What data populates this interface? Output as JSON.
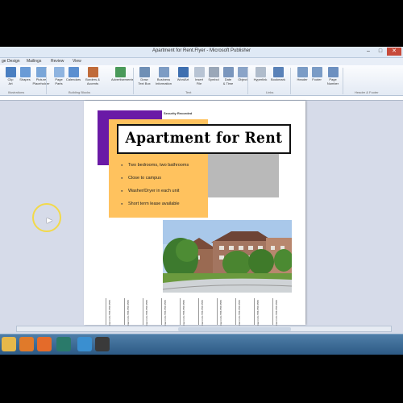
{
  "window": {
    "title": "Apartment for Rent.Flyer - Microsoft Publisher"
  },
  "menu": [
    "ge Design",
    "Mailings",
    "Review",
    "View"
  ],
  "ribbon": {
    "buttons": [
      {
        "label": "Clip\nArt",
        "color": "#4a7fc1"
      },
      {
        "label": "Shapes",
        "color": "#6a9bd6"
      },
      {
        "label": "Picture\nPlaceholder",
        "color": "#7aa6d8"
      },
      {
        "label": "Page\nParts",
        "color": "#8fb4e0"
      },
      {
        "label": "Calendars",
        "color": "#5b8fd0"
      },
      {
        "label": "Borders &\nAccents",
        "color": "#c06b3a"
      },
      {
        "label": "Advertisements",
        "color": "#4a9a5a"
      },
      {
        "label": "Draw\nText Box",
        "color": "#6f8fb5"
      },
      {
        "label": "Business\nInformation",
        "color": "#7d9cc4"
      },
      {
        "label": "WordArt",
        "color": "#3e6fb0"
      },
      {
        "label": "Insert\nFile",
        "color": "#b8c4d4"
      },
      {
        "label": "Symbol",
        "color": "#9aa7b8"
      },
      {
        "label": "Date\n& Time",
        "color": "#7a96bd"
      },
      {
        "label": "Object",
        "color": "#8aa4c8"
      },
      {
        "label": "Hyperlink",
        "color": "#b0bccb"
      },
      {
        "label": "Bookmark",
        "color": "#5a82b8"
      },
      {
        "label": "Header",
        "color": "#7b9cc6"
      },
      {
        "label": "Footer",
        "color": "#7b9cc6"
      },
      {
        "label": "Page\nNumber",
        "color": "#6d90c0"
      }
    ],
    "groups": [
      "Illustrations",
      "Building Blocks",
      "Text",
      "Links",
      "Header & Footer"
    ]
  },
  "document": {
    "title": "Apartment for Rent",
    "control_label": "Security Recorded",
    "bullets": [
      "Two bedrooms, two bathrooms",
      "Close to campus",
      "Washer/Dryer in each unit",
      "Short term lease available"
    ],
    "tear_off_text": "Contact Info 555-555-5555"
  },
  "taskbar": {
    "items": [
      {
        "name": "file-explorer",
        "color": "#e7b84a"
      },
      {
        "name": "media-player",
        "color": "#e07a2a"
      },
      {
        "name": "firefox",
        "color": "#e46b2a"
      },
      {
        "name": "publisher",
        "color": "#2a7a6a"
      },
      {
        "name": "app-icon",
        "color": "#3a8fd0"
      },
      {
        "name": "recorder",
        "color": "#3a3a3a"
      }
    ]
  },
  "accent": {
    "purple": "#6a1aa6",
    "orange": "#ffc25e",
    "gray": "#b9b9b9"
  }
}
